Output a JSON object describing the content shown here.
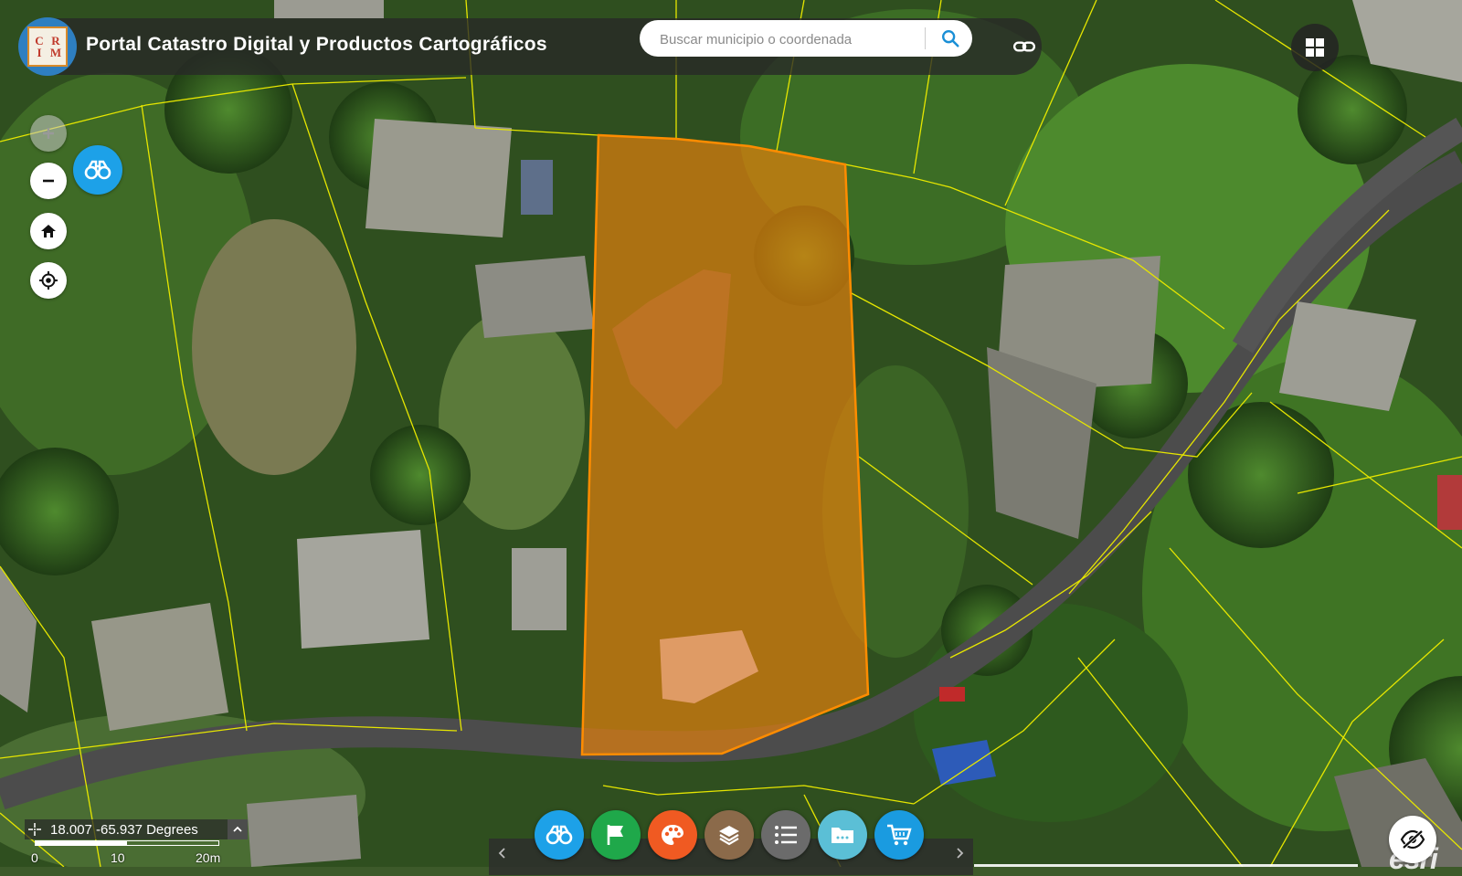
{
  "header": {
    "title": "Portal Catastro Digital y Productos Cartográficos",
    "logo_text": [
      "C",
      "R",
      "I",
      "M"
    ]
  },
  "search": {
    "placeholder": "Buscar municipio o coordenada",
    "value": ""
  },
  "icons": {
    "logo": "crim-logo-icon",
    "search": "search-icon",
    "link": "link-icon",
    "apps": "grid-apps-icon",
    "zoom_in": "plus-icon",
    "zoom_out": "minus-icon",
    "home": "home-icon",
    "locate": "locate-icon",
    "binoculars": "binoculars-icon",
    "flag": "flag-icon",
    "palette": "palette-icon",
    "layers": "layers-icon",
    "list": "list-icon",
    "folder": "folder-icon",
    "cart": "cart-icon",
    "eye_off": "eye-off-icon"
  },
  "coordinates": {
    "text": "18.007 -65.937 Degrees"
  },
  "scale": {
    "labels": [
      "0",
      "10",
      "20m"
    ]
  },
  "attribution": {
    "text": "esri"
  },
  "colors": {
    "parcel_fill": "#e8820c",
    "parcel_stroke": "#ff8c00",
    "parcel_lines": "#e6e600",
    "accent_blue": "#1da1e8",
    "flag_green": "#1fa84a",
    "palette_orange": "#f05a22",
    "layers_brown": "#8b6a4a",
    "list_gray": "#6b6b6b",
    "folder_teal": "#5bbfd6",
    "cart_blue": "#1a9be0"
  }
}
